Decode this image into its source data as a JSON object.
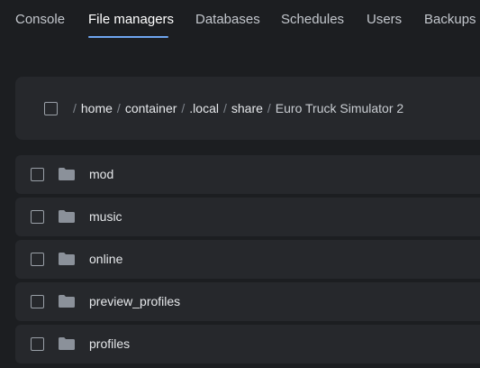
{
  "tabs": [
    {
      "label": "Console",
      "active": false
    },
    {
      "label": "File managers",
      "active": true
    },
    {
      "label": "Databases",
      "active": false
    },
    {
      "label": "Schedules",
      "active": false
    },
    {
      "label": "Users",
      "active": false
    },
    {
      "label": "Backups",
      "active": false
    }
  ],
  "breadcrumb": {
    "separator": "/",
    "parts": [
      "home",
      "container",
      ".local",
      "share"
    ],
    "current": "Euro Truck Simulator 2"
  },
  "files": [
    {
      "name": "mod",
      "type": "folder",
      "icon": "folder-icon"
    },
    {
      "name": "music",
      "type": "folder",
      "icon": "folder-icon"
    },
    {
      "name": "online",
      "type": "folder",
      "icon": "folder-icon"
    },
    {
      "name": "preview_profiles",
      "type": "folder",
      "icon": "folder-icon"
    },
    {
      "name": "profiles",
      "type": "folder",
      "icon": "folder-icon"
    }
  ],
  "colors": {
    "background": "#1c1e21",
    "panel": "#26282c",
    "accent": "#6ea5ef",
    "folder": "#8b919a"
  }
}
